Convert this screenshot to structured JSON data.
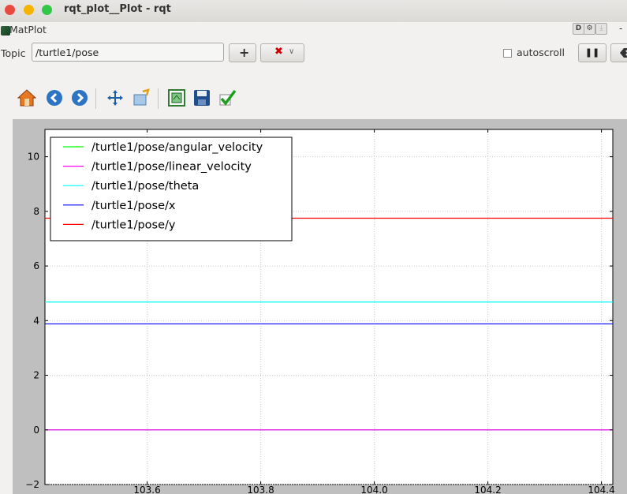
{
  "window": {
    "title": "rqt_plot__Plot - rqt"
  },
  "dock": {
    "title": "MatPlot"
  },
  "topic": {
    "label": "Topic",
    "value": "/turtle1/pose"
  },
  "autoscroll": {
    "label": "autoscroll",
    "checked": false
  },
  "toolbar": {
    "icons": [
      "home-icon",
      "back-icon",
      "forward-icon",
      "pan-icon",
      "zoom-icon",
      "subplots-icon",
      "save-icon",
      "edit-curves-icon"
    ]
  },
  "colors": {
    "angular": "#00ff00",
    "linear": "#ff00ff",
    "theta": "#00ffff",
    "x": "#0000ff",
    "y": "#ff0000"
  },
  "chart_data": {
    "type": "line",
    "xlim": [
      103.42,
      104.42
    ],
    "ylim": [
      -2,
      11
    ],
    "xticks": [
      103.6,
      103.8,
      104.0,
      104.2,
      104.4
    ],
    "yticks": [
      -2,
      0,
      2,
      4,
      6,
      8,
      10
    ],
    "xtick_labels": [
      "103.6",
      "103.8",
      "104.0",
      "104.2",
      "104.4"
    ],
    "ytick_labels": [
      "−2",
      "0",
      "2",
      "4",
      "6",
      "8",
      "10"
    ],
    "grid": true,
    "legend_position": "top-left",
    "series": [
      {
        "name": "/turtle1/pose/angular_velocity",
        "color": "#00ff00",
        "x": [
          103.42,
          104.42
        ],
        "y": [
          0.0,
          0.0
        ]
      },
      {
        "name": "/turtle1/pose/linear_velocity",
        "color": "#ff00ff",
        "x": [
          103.42,
          104.42
        ],
        "y": [
          0.0,
          0.0
        ]
      },
      {
        "name": "/turtle1/pose/theta",
        "color": "#00ffff",
        "x": [
          103.42,
          104.42
        ],
        "y": [
          4.68,
          4.68
        ]
      },
      {
        "name": "/turtle1/pose/x",
        "color": "#0000ff",
        "x": [
          103.42,
          104.42
        ],
        "y": [
          3.88,
          3.88
        ]
      },
      {
        "name": "/turtle1/pose/y",
        "color": "#ff0000",
        "x": [
          103.42,
          104.42
        ],
        "y": [
          7.75,
          7.75
        ]
      }
    ]
  }
}
